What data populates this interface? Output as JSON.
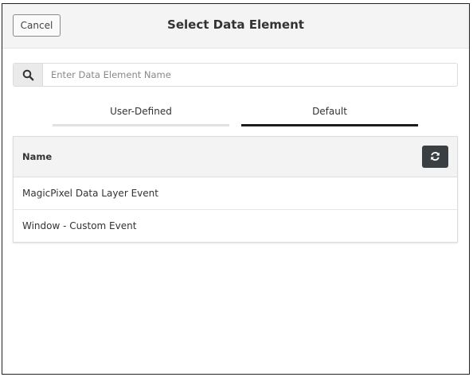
{
  "dialog": {
    "title": "Select Data Element",
    "cancel_label": "Cancel"
  },
  "search": {
    "icon": "search-icon",
    "placeholder": "Enter Data Element Name",
    "value": ""
  },
  "tabs": [
    {
      "label": "User-Defined",
      "active": false
    },
    {
      "label": "Default",
      "active": true
    }
  ],
  "table": {
    "columns": [
      "Name"
    ],
    "refresh_icon": "refresh-icon",
    "rows": [
      {
        "name": "MagicPixel Data Layer Event"
      },
      {
        "name": "Window - Custom Event"
      }
    ]
  }
}
